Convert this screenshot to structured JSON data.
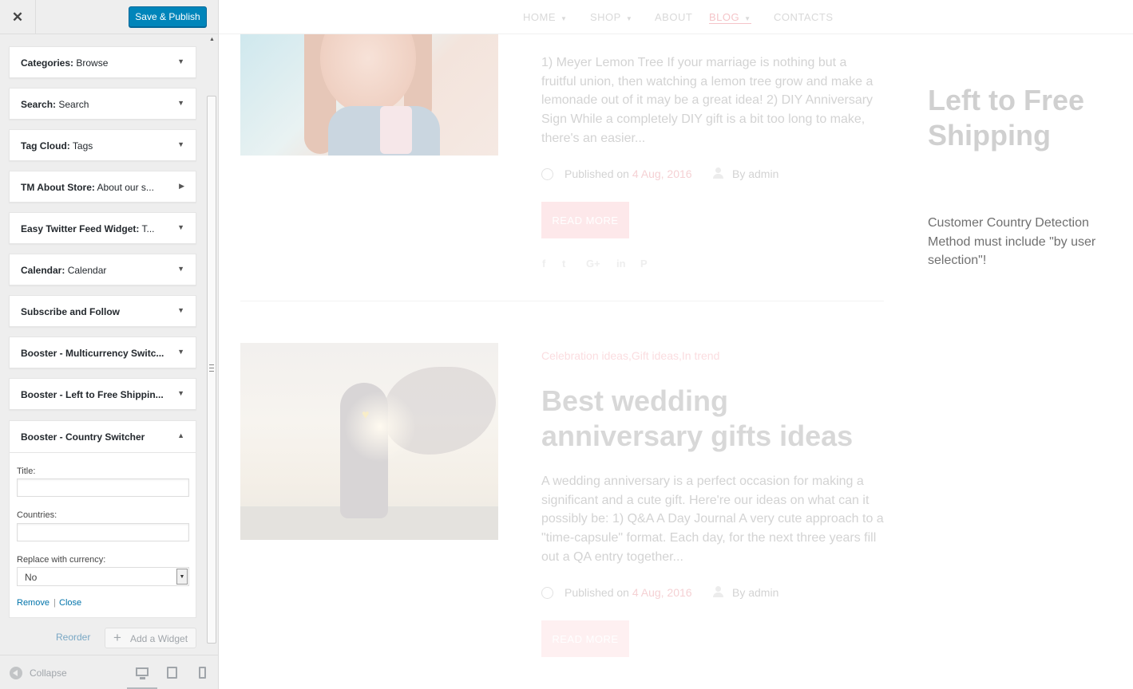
{
  "sidebar": {
    "close_icon": "close-icon",
    "save_label": "Save & Publish",
    "widgets": [
      {
        "type": "Categories:",
        "title": "Browse",
        "expanded": false
      },
      {
        "type": "Search:",
        "title": "Search",
        "expanded": false
      },
      {
        "type": "Tag Cloud:",
        "title": "Tags",
        "expanded": false
      },
      {
        "type": "TM About Store:",
        "title": "About our s...",
        "expanded": false
      },
      {
        "type": "Easy Twitter Feed Widget:",
        "title": "T...",
        "expanded": false
      },
      {
        "type": "Calendar:",
        "title": "Calendar",
        "expanded": false
      },
      {
        "type": "Subscribe and Follow",
        "title": "",
        "expanded": false
      },
      {
        "type": "Booster - Multicurrency Switc...",
        "title": "",
        "expanded": false
      },
      {
        "type": "Booster - Left to Free Shippin...",
        "title": "",
        "expanded": false
      }
    ],
    "open_widget": {
      "title": "Booster - Country Switcher",
      "fields": {
        "title_label": "Title:",
        "title_value": "",
        "countries_label": "Countries:",
        "countries_value": "",
        "currency_label": "Replace with currency:",
        "currency_value": "No"
      },
      "remove_label": "Remove",
      "separator": "|",
      "close_label": "Close"
    },
    "reorder_label": "Reorder",
    "add_widget_label": "Add a Widget",
    "footer": {
      "collapse_label": "Collapse",
      "active_device": "desktop"
    }
  },
  "preview": {
    "nav": [
      {
        "label": "HOME",
        "has_dropdown": true
      },
      {
        "label": "SHOP",
        "has_dropdown": true
      },
      {
        "label": "ABOUT",
        "has_dropdown": false
      },
      {
        "label": "BLOG",
        "has_dropdown": true,
        "active": true
      },
      {
        "label": "CONTACTS",
        "has_dropdown": false
      }
    ],
    "post1": {
      "excerpt": "1) Meyer Lemon Tree If your marriage is nothing but a fruitful union, then watching a lemon tree grow and make a lemonade out of it may be a great idea! 2) DIY Anniversary Sign While a completely DIY gift is a bit too long to make, there's an easier...",
      "published_prefix": "Published on",
      "date": "4 Aug, 2016",
      "author": "By admin",
      "read_more": "READ MORE"
    },
    "post2": {
      "categories": "Celebration ideas,Gift ideas,In trend",
      "title": "Best wedding anniversary gifts ideas",
      "excerpt": "A wedding anniversary is a perfect occasion for making a significant and a cute gift. Here're our ideas on what can it possibly be: 1) Q&A A Day Journal A very cute approach to a \"time-capsule\" format. Each day, for the next three years fill out a QA entry together...",
      "published_prefix": "Published on",
      "date": "4 Aug, 2016",
      "author": "By admin",
      "read_more": "READ MORE"
    },
    "social_icons": [
      "facebook-icon",
      "twitter-icon",
      "google-plus-icon",
      "linkedin-icon",
      "pinterest-icon"
    ],
    "sidebar_widget": {
      "heading": "Left to Free Shipping",
      "message": "Customer Country Detection Method must include \"by user selection\"!"
    }
  },
  "colors": {
    "primary_button": "#0085ba",
    "link": "#0073aa",
    "accent_pink": "#f5c5c9"
  }
}
